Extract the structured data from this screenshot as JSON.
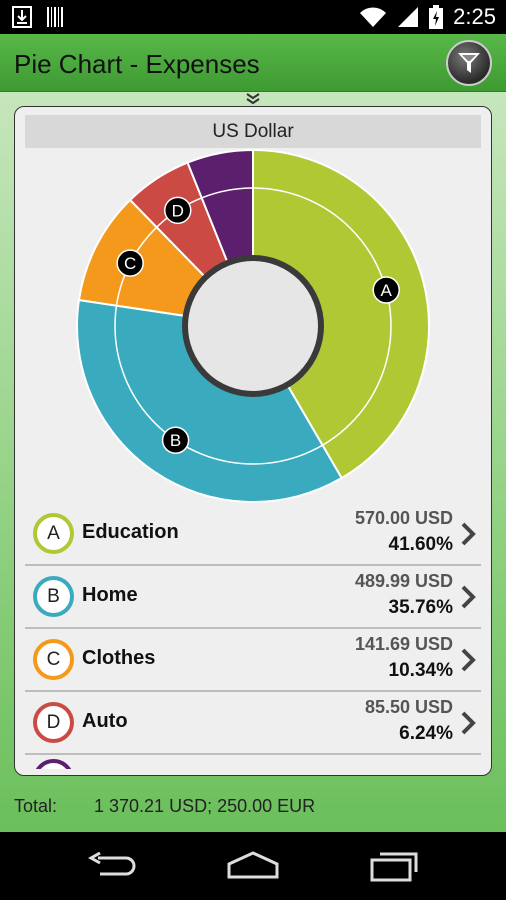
{
  "status_bar": {
    "time": "2:25"
  },
  "app": {
    "title": "Pie Chart - Expenses"
  },
  "card": {
    "currency": "US Dollar"
  },
  "chart_data": {
    "type": "pie",
    "title": "",
    "slices": [
      {
        "label": "A",
        "name": "Education",
        "value": 570.0,
        "percent": 41.6,
        "color": "#afc834"
      },
      {
        "label": "B",
        "name": "Home",
        "value": 489.99,
        "percent": 35.76,
        "color": "#3aabbf"
      },
      {
        "label": "C",
        "name": "Clothes",
        "value": 141.69,
        "percent": 10.34,
        "color": "#f4991c"
      },
      {
        "label": "D",
        "name": "Auto",
        "value": 85.5,
        "percent": 6.24,
        "color": "#cc4a44"
      },
      {
        "label": "",
        "name": "",
        "value": null,
        "percent": 6.06,
        "color": "#5b1f6e"
      }
    ]
  },
  "list": {
    "rows": [
      {
        "letter": "A",
        "name": "Education",
        "amount": "570.00 USD",
        "percent": "41.60%",
        "color": "#afc834"
      },
      {
        "letter": "B",
        "name": "Home",
        "amount": "489.99 USD",
        "percent": "35.76%",
        "color": "#3aabbf"
      },
      {
        "letter": "C",
        "name": "Clothes",
        "amount": "141.69 USD",
        "percent": "10.34%",
        "color": "#f4991c"
      },
      {
        "letter": "D",
        "name": "Auto",
        "amount": "85.50 USD",
        "percent": "6.24%",
        "color": "#cc4a44"
      }
    ],
    "partial_row": {
      "color": "#5b1f6e"
    }
  },
  "total": {
    "label": "Total:",
    "value": "1 370.21 USD; 250.00 EUR"
  }
}
